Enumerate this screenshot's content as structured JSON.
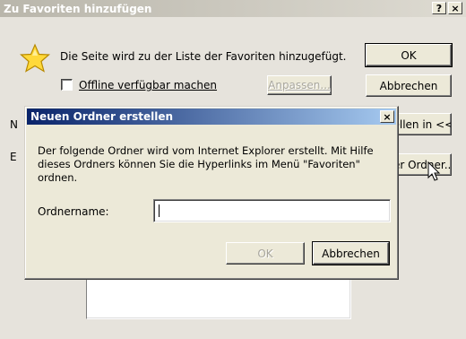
{
  "outer_dialog": {
    "title": "Zu Favoriten hinzufügen",
    "help_button": "?",
    "close_button": "×",
    "message": "Die Seite wird zu der Liste der Favoriten hinzugefügt.",
    "offline_checkbox": {
      "label": "Offline verfügbar machen",
      "checked": false
    },
    "customize_button": "Anpassen...",
    "ok_button": "OK",
    "cancel_button": "Abbrechen",
    "create_in_button": "Erstellen in <<",
    "new_folder_button": "Neuer Ordner...",
    "partial_labels": {
      "name_initial": "N",
      "create_in_initial": "E"
    }
  },
  "inner_dialog": {
    "title": "Neuen Ordner erstellen",
    "close_button": "×",
    "description": "Der folgende Ordner wird vom Internet Explorer erstellt. Mit Hilfe dieses Ordners können Sie die Hyperlinks im Menü \"Favoriten\" ordnen.",
    "folder_name_label": "Ordnername:",
    "folder_name_value": "",
    "ok_button": "OK",
    "cancel_button": "Abbrechen"
  },
  "colors": {
    "outer_title_inactive": "#b9b6ab",
    "inner_title_start": "#0a246a",
    "inner_title_end": "#a6caf0",
    "dialog_face": "#ece9d8"
  }
}
